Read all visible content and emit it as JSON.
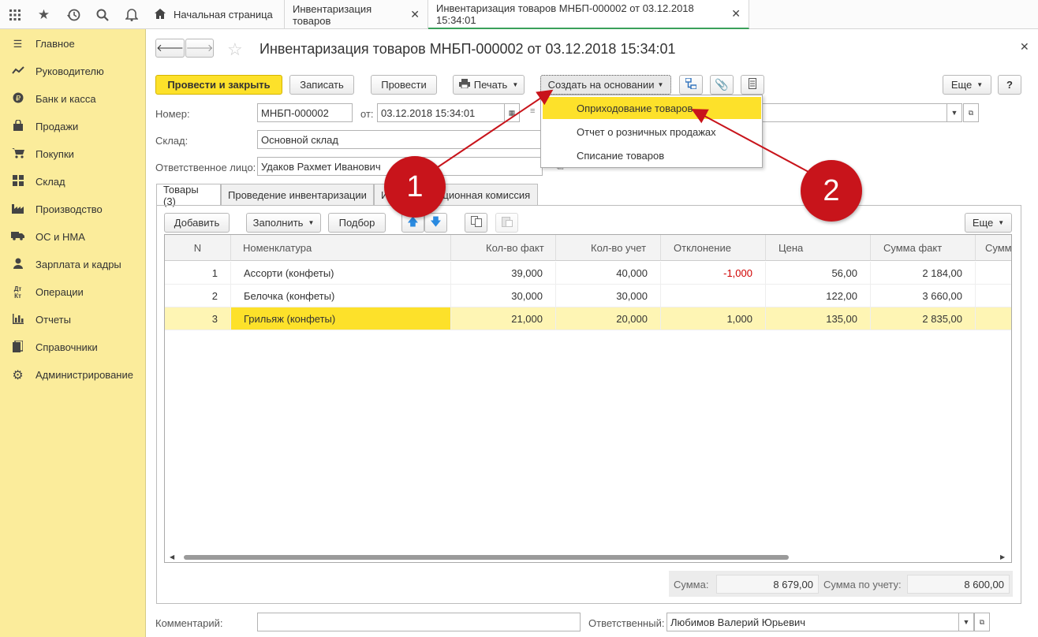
{
  "tabs": [
    {
      "label": "Начальная страница"
    },
    {
      "label": "Инвентаризация товаров"
    },
    {
      "label": "Инвентаризация товаров МНБП-000002 от 03.12.2018 15:34:01"
    }
  ],
  "sidebar": {
    "items": [
      {
        "label": "Главное",
        "icon": "menu-icon"
      },
      {
        "label": "Руководителю",
        "icon": "trend-icon"
      },
      {
        "label": "Банк и касса",
        "icon": "coin-icon"
      },
      {
        "label": "Продажи",
        "icon": "bag-icon"
      },
      {
        "label": "Покупки",
        "icon": "cart-icon"
      },
      {
        "label": "Склад",
        "icon": "grid-icon"
      },
      {
        "label": "Производство",
        "icon": "factory-icon"
      },
      {
        "label": "ОС и НМА",
        "icon": "truck-icon"
      },
      {
        "label": "Зарплата и кадры",
        "icon": "person-icon"
      },
      {
        "label": "Операции",
        "icon": "dt-kt-icon"
      },
      {
        "label": "Отчеты",
        "icon": "bar-chart-icon"
      },
      {
        "label": "Справочники",
        "icon": "book-icon"
      },
      {
        "label": "Администрирование",
        "icon": "gear-icon"
      }
    ]
  },
  "doc": {
    "title": "Инвентаризация товаров МНБП-000002 от 03.12.2018 15:34:01"
  },
  "toolbar": {
    "post_close": "Провести и закрыть",
    "save": "Записать",
    "post": "Провести",
    "print": "Печать",
    "create_based": "Создать на основании",
    "more": "Еще",
    "help": "?"
  },
  "fields": {
    "number_label": "Номер:",
    "number": "МНБП-000002",
    "date_label": "от:",
    "date": "03.12.2018 15:34:01",
    "warehouse_label": "Склад:",
    "warehouse": "Основной склад",
    "responsible_label": "Ответственное лицо:",
    "responsible": "Удаков Рахмет Иванович"
  },
  "menu": {
    "items": [
      "Оприходование товаров",
      "Отчет о розничных продажах",
      "Списание товаров"
    ]
  },
  "form_tabs": [
    "Товары (3)",
    "Проведение инвентаризации",
    "Инвентаризационная комиссия"
  ],
  "grid_toolbar": {
    "add": "Добавить",
    "fill": "Заполнить",
    "select": "Подбор",
    "more": "Еще"
  },
  "table": {
    "headers": [
      "N",
      "Номенклатура",
      "Кол-во факт",
      "Кол-во учет",
      "Отклонение",
      "Цена",
      "Сумма факт",
      "Сумма"
    ],
    "rows": [
      [
        "1",
        "Ассорти (конфеты)",
        "39,000",
        "40,000",
        "-1,000",
        "56,00",
        "2 184,00"
      ],
      [
        "2",
        "Белочка (конфеты)",
        "30,000",
        "30,000",
        "",
        "122,00",
        "3 660,00"
      ],
      [
        "3",
        "Грильяж (конфеты)",
        "21,000",
        "20,000",
        "1,000",
        "135,00",
        "2 835,00"
      ]
    ]
  },
  "totals": {
    "sum_label": "Сумма:",
    "sum": "8 679,00",
    "sum_acc_label": "Сумма по учету:",
    "sum_acc": "8 600,00"
  },
  "footer": {
    "comment_label": "Комментарий:",
    "comment": "",
    "resp_label": "Ответственный:",
    "resp": "Любимов Валерий Юрьевич"
  },
  "annotations": {
    "one": "1",
    "two": "2"
  },
  "colors": {
    "accent": "#fde12a",
    "sidebar": "#fbec9b",
    "negative": "#d00000",
    "annotation": "#c8141b"
  }
}
